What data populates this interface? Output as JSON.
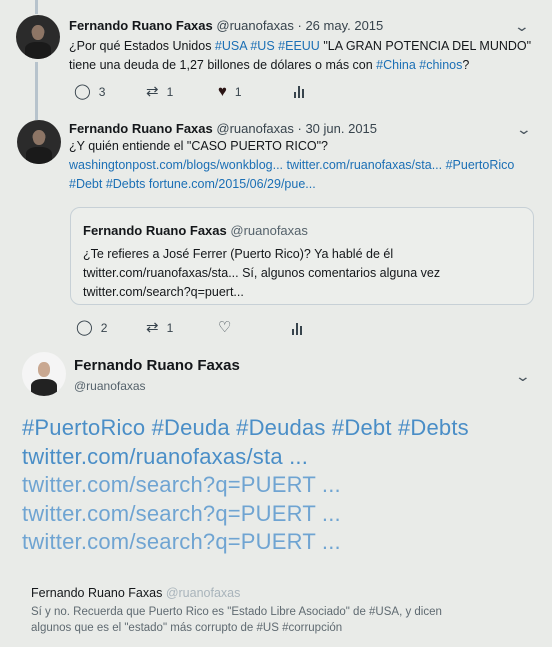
{
  "tweet1": {
    "name": "Fernando Ruano Faxas",
    "handle_date": "@ruanofaxas · 26 may. 2015",
    "text": "¿Por qué Estados Unidos ",
    "tags1": "#USA #US #EEUU",
    "text2": " \"LA GRAN POTENCIA DEL MUNDO\"",
    "line2": "tiene una deuda de 1,27 billones de dólares o más con ",
    "tags2": "#China #chinos",
    "line2_end": "?",
    "replies": "3",
    "retweets": "1",
    "likes": "1"
  },
  "tweet2": {
    "name": "Fernando Ruano Faxas",
    "handle_date": "@ruanofaxas · 30 jun. 2015",
    "line1": "¿Y quién entiende el \"CASO PUERTO RICO\"?",
    "line2": "washingtonpost.com/blogs/wonkblog... twitter.com/ruanofaxas/sta... #PuertoRico",
    "line3": "#Debt #Debts fortune.com/2015/06/29/pue...",
    "quote": {
      "name": "Fernando Ruano Faxas",
      "handle": "@ruanofaxas",
      "line1": "¿Te refieres a José Ferrer (Puerto Rico)? Ya hablé de él",
      "line2": "twitter.com/ruanofaxas/sta... Sí, algunos comentarios alguna vez",
      "line3": "twitter.com/search?q=puert..."
    },
    "replies": "2",
    "retweets": "1",
    "likes": ""
  },
  "tweet3": {
    "name": "Fernando Ruano Faxas",
    "handle": "@ruanofaxas",
    "lines": [
      "#PuertoRico #Deuda #Deudas #Debt #Debts",
      "twitter.com/ruanofaxas/sta ...",
      "twitter.com/search?q=PUERT ...",
      "twitter.com/search?q=PUERT ...",
      "twitter.com/search?q=PUERT ..."
    ]
  },
  "reply": {
    "name": "Fernando Ruano Faxas",
    "handle": "@ruanofaxas",
    "line1": "Sí y no. Recuerda que Puerto Rico es \"Estado Libre Asociado\" de #USA, y dicen",
    "line2": "algunos que es el \"estado\" más corrupto de #US #corrupción"
  },
  "colors": {
    "link": "#1b6fb5",
    "big_text": "#4a8ec7",
    "background": "#e9ebe8"
  },
  "icons": [
    "reply-icon",
    "retweet-icon",
    "like-icon",
    "analytics-icon",
    "chevron-down-icon"
  ]
}
